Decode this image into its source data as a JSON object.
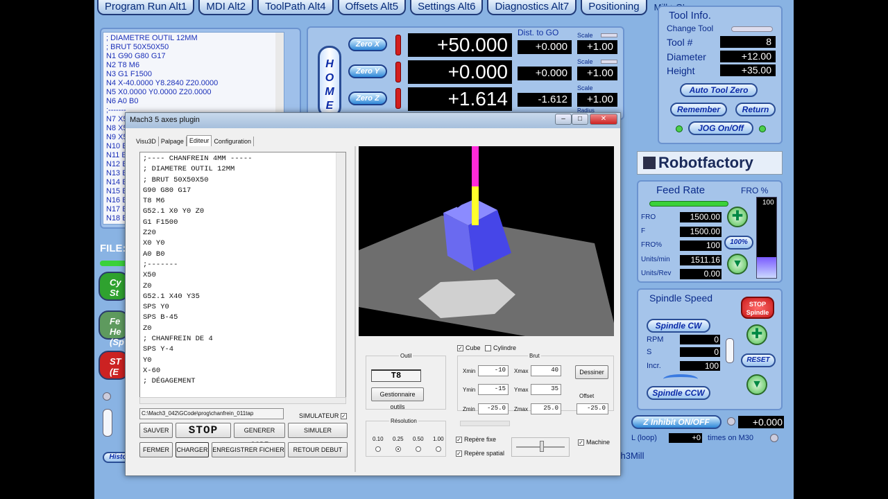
{
  "tabs": [
    "Program Run Alt1",
    "MDI Alt2",
    "ToolPath Alt4",
    "Offsets Alt5",
    "Settings Alt6",
    "Diagnostics Alt7",
    "Positioning"
  ],
  "tab_extra": "Mill->G'",
  "gcode_lines": [
    "; DIAMETRE OUTIL 12MM",
    "; BRUT 50X50X50",
    "N1 G90 G80 G17",
    "N2 T8 M6",
    "N3 G1 F1500",
    "N4 X-40.0000 Y8.2840 Z20.0000",
    "N5 X0.0000 Y0.0000 Z20.0000",
    "N6 A0 B0",
    ";-------",
    "N7 X5",
    "N8 X5",
    "N9 X5",
    "N10 E",
    "N11 E",
    "N12 E",
    "N13 E",
    "N14 E",
    "N15 E",
    "N16 E",
    "N17 E",
    "N18 E"
  ],
  "file_label": "FILE:",
  "side_buttons": [
    "Cy St",
    "Fe He (Sp",
    "ST (E"
  ],
  "side_history": "Histo",
  "home_label": "HOME",
  "dist_to_go": "Dist. to GO",
  "scale_label": "Scale",
  "radius_label": "Radius",
  "axes": [
    {
      "zero": "Zero X",
      "dro": "+50.000",
      "dist": "+0.000",
      "scale": "+1.00"
    },
    {
      "zero": "Zero Y",
      "dro": "+0.000",
      "dist": "+0.000",
      "scale": "+1.00"
    },
    {
      "zero": "Zero Z",
      "dro": "+1.614",
      "dist": "-1.612",
      "scale": "+1.00"
    }
  ],
  "tool_info": {
    "title": "Tool Info.",
    "change_tool": "Change Tool",
    "tool_no_label": "Tool #",
    "tool_no": "8",
    "diameter_label": "Diameter",
    "diameter": "+12.00",
    "height_label": "Height",
    "height": "+35.00",
    "auto_zero": "Auto Tool Zero",
    "remember": "Remember",
    "return": "Return",
    "jog": "JOG On/Off"
  },
  "brand": "Robotfactory",
  "feed": {
    "title": "Feed Rate",
    "fro_title": "FRO %",
    "fro_label": "FRO",
    "fro": "1500.00",
    "f_label": "F",
    "f": "1500.00",
    "frop_label": "FRO%",
    "frop": "100",
    "units_min_label": "Units/min",
    "units_min": "1511.16",
    "units_rev_label": "Units/Rev",
    "units_rev": "0.00",
    "btn100": "100%",
    "bar_value": "100"
  },
  "spindle": {
    "title": "Spindle Speed",
    "stop": "STOP Spindle",
    "cw": "Spindle CW",
    "ccw": "Spindle CCW",
    "rpm_label": "RPM",
    "rpm": "0",
    "s_label": "S",
    "s": "0",
    "incr_label": "Incr.",
    "incr": "100",
    "reset": "RESET"
  },
  "z_inhibit": "Z Inhibit ON/OFF",
  "z_inhibit_value": "+0.000",
  "loop_label": "L (loop)",
  "loop_value": "+0",
  "loop_suffix": "times on M30",
  "mach3mill": "ch3Mill",
  "dialog": {
    "title": "Mach3 5 axes plugin",
    "tabs": [
      "Visu3D",
      "Palpage",
      "Editeur",
      "Configuration"
    ],
    "editor_lines": [
      ";---- CHANFREIN 4MM -----",
      "; DIAMETRE OUTIL 12MM",
      "; BRUT 50X50X50",
      "G90 G80 G17",
      "T8 M6",
      "G52.1 X0 Y0 Z0",
      "G1 F1500",
      "Z20",
      "X0 Y0",
      "A0 B0",
      ";-------",
      "X50",
      "Z0",
      "G52.1 X40 Y35",
      "SPS Y0",
      "SPS B-45",
      "Z0",
      "; CHANFREIN DE 4",
      "SPS Y-4",
      "Y0",
      "X-60",
      "; DÉGAGEMENT"
    ],
    "path": "C:\\Mach3_042\\GCode\\prog\\chanfrein_011tap",
    "simulateur": "SIMULATEUR",
    "buttons": {
      "sauver": "SAUVER",
      "stop": "STOP",
      "generer": "GENERER CODE",
      "simuler": "SIMULER",
      "fermer": "FERMER",
      "charger": "CHARGER",
      "enregistrer": "ENREGISTRER FICHIER",
      "retour": "RETOUR DEBUT"
    },
    "outil_label": "Outil",
    "outil_value": "T8",
    "gestionnaire": "Gestionnaire outils",
    "resolution_label": "Résolution",
    "resolutions": [
      "0.10",
      "0.25",
      "0.50",
      "1.00"
    ],
    "cube": "Cube",
    "cylindre": "Cylindre",
    "brut_label": "Brut",
    "xmin_label": "Xmin",
    "xmin": "-10",
    "xmax_label": "Xmax",
    "xmax": "40",
    "ymin_label": "Ymin",
    "ymin": "-15",
    "ymax_label": "Ymax",
    "ymax": "35",
    "zmin_label": "Zmin",
    "zmin": "-25.0",
    "zmax_label": "Zmax",
    "zmax": "25.0",
    "dessiner": "Dessiner",
    "offset_label": "Offset",
    "offset": "-25.0",
    "repere_fixe": "Repère fixe",
    "repere_spatial": "Repère spatial",
    "machine": "Machine"
  }
}
